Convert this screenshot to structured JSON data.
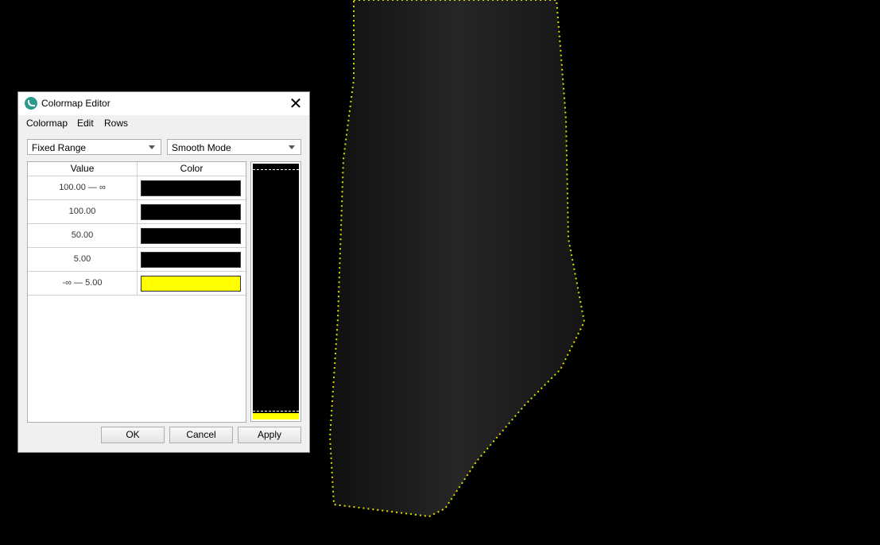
{
  "dialog": {
    "title": "Colormap Editor",
    "close_icon": "close-icon"
  },
  "menu": [
    "Colormap",
    "Edit",
    "Rows"
  ],
  "range_mode": "Fixed Range",
  "interp_mode": "Smooth Mode",
  "table": {
    "headers": [
      "Value",
      "Color"
    ],
    "rows": [
      {
        "value": "100.00  —  ∞",
        "color": "#000000"
      },
      {
        "value": "100.00",
        "color": "#000000"
      },
      {
        "value": "50.00",
        "color": "#000000"
      },
      {
        "value": "5.00",
        "color": "#000000"
      },
      {
        "value": "-∞  —  5.00",
        "color": "#ffff00"
      }
    ]
  },
  "buttons": {
    "ok": "OK",
    "cancel": "Cancel",
    "apply": "Apply"
  }
}
